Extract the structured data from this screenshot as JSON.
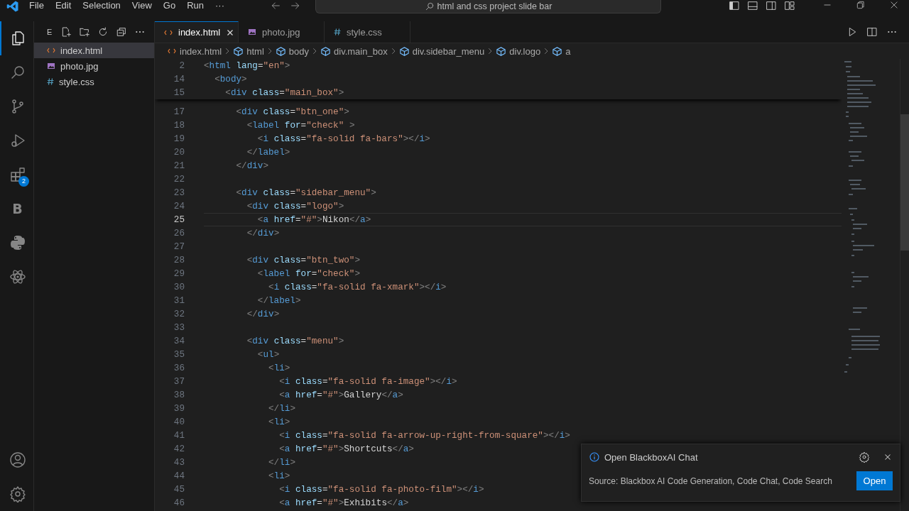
{
  "menu_bar": {
    "items": [
      "File",
      "Edit",
      "Selection",
      "View",
      "Go",
      "Run",
      "···"
    ],
    "search": "html and css project slide bar"
  },
  "activity_bar": {
    "items": [
      {
        "kind": "explorer",
        "selected": true
      },
      {
        "kind": "search",
        "selected": false
      },
      {
        "kind": "source-control",
        "selected": false
      },
      {
        "kind": "debug",
        "selected": false
      },
      {
        "kind": "extensions",
        "selected": false,
        "badge": "2"
      },
      {
        "kind": "letter",
        "selected": false,
        "label": "B"
      },
      {
        "kind": "python",
        "selected": false
      },
      {
        "kind": "react",
        "selected": false
      }
    ],
    "bottom": [
      {
        "kind": "account"
      },
      {
        "kind": "settings"
      }
    ]
  },
  "sidebar": {
    "title": "E",
    "files": [
      {
        "name": "index.html",
        "kind": "html",
        "selected": true
      },
      {
        "name": "photo.jpg",
        "kind": "image",
        "selected": false
      },
      {
        "name": "style.css",
        "kind": "css",
        "selected": false
      }
    ]
  },
  "tabs": [
    {
      "label": "index.html",
      "kind": "html",
      "selected": true
    },
    {
      "label": "photo.jpg",
      "kind": "image",
      "selected": false
    },
    {
      "label": "style.css",
      "kind": "css",
      "selected": false
    }
  ],
  "breadcrumbs": [
    {
      "label": "index.html",
      "kind": "html"
    },
    {
      "label": "html",
      "kind": "element"
    },
    {
      "label": "body",
      "kind": "element"
    },
    {
      "label": "div.main_box",
      "kind": "element"
    },
    {
      "label": "div.sidebar_menu",
      "kind": "element"
    },
    {
      "label": "div.logo",
      "kind": "element"
    },
    {
      "label": "a",
      "kind": "element"
    }
  ],
  "sticky_lines": [
    {
      "number": "2",
      "code": "<html lang=\"en\">"
    },
    {
      "number": "14",
      "code": "  <body>"
    },
    {
      "number": "15",
      "code": "    <div class=\"main_box\">"
    }
  ],
  "code_lines": [
    {
      "number": "17",
      "code": "      <div class=\"btn_one\">",
      "current": false
    },
    {
      "number": "18",
      "code": "        <label for=\"check\" >",
      "current": false
    },
    {
      "number": "19",
      "code": "          <i class=\"fa-solid fa-bars\"></i>",
      "current": false
    },
    {
      "number": "20",
      "code": "        </label>",
      "current": false
    },
    {
      "number": "21",
      "code": "      </div>",
      "current": false
    },
    {
      "number": "22",
      "current": false
    },
    {
      "number": "23",
      "code": "      <div class=\"sidebar_menu\">",
      "current": false
    },
    {
      "number": "24",
      "code": "        <div class=\"logo\">",
      "current": false
    },
    {
      "number": "25",
      "code": "          <a href=\"#\">Nikon</a>",
      "current": true
    },
    {
      "number": "26",
      "code": "        </div>",
      "current": false
    },
    {
      "number": "27",
      "current": false
    },
    {
      "number": "28",
      "code": "        <div class=\"btn_two\">",
      "current": false
    },
    {
      "number": "29",
      "code": "          <label for=\"check\">",
      "current": false
    },
    {
      "number": "30",
      "code": "            <i class=\"fa-solid fa-xmark\"></i>",
      "current": false
    },
    {
      "number": "31",
      "code": "          </label>",
      "current": false
    },
    {
      "number": "32",
      "code": "        </div>",
      "current": false
    },
    {
      "number": "33",
      "current": false
    },
    {
      "number": "34",
      "code": "        <div class=\"menu\">",
      "current": false
    },
    {
      "number": "35",
      "code": "          <ul>",
      "current": false
    },
    {
      "number": "36",
      "code": "            <li>",
      "current": false
    },
    {
      "number": "37",
      "code": "              <i class=\"fa-solid fa-image\"></i>",
      "current": false
    },
    {
      "number": "38",
      "code": "              <a href=\"#\">Gallery</a>",
      "current": false
    },
    {
      "number": "39",
      "code": "            </li>",
      "current": false
    },
    {
      "number": "40",
      "code": "            <li>",
      "current": false
    },
    {
      "number": "41",
      "code": "              <i class=\"fa-solid fa-arrow-up-right-from-square\"></i>",
      "current": false
    },
    {
      "number": "42",
      "code": "              <a href=\"#\">Shortcuts</a>",
      "current": false
    },
    {
      "number": "43",
      "code": "            </li>",
      "current": false
    },
    {
      "number": "44",
      "code": "            <li>",
      "current": false
    },
    {
      "number": "45",
      "code": "              <i class=\"fa-solid fa-photo-film\"></i>",
      "current": false
    },
    {
      "number": "46",
      "code": "              <a href=\"#\">Exhibits</a>",
      "current": false
    }
  ],
  "notification": {
    "title": "Open BlackboxAI Chat",
    "source": "Source: Blackbox AI Code Generation, Code Chat, Code Search",
    "button": "Open"
  }
}
